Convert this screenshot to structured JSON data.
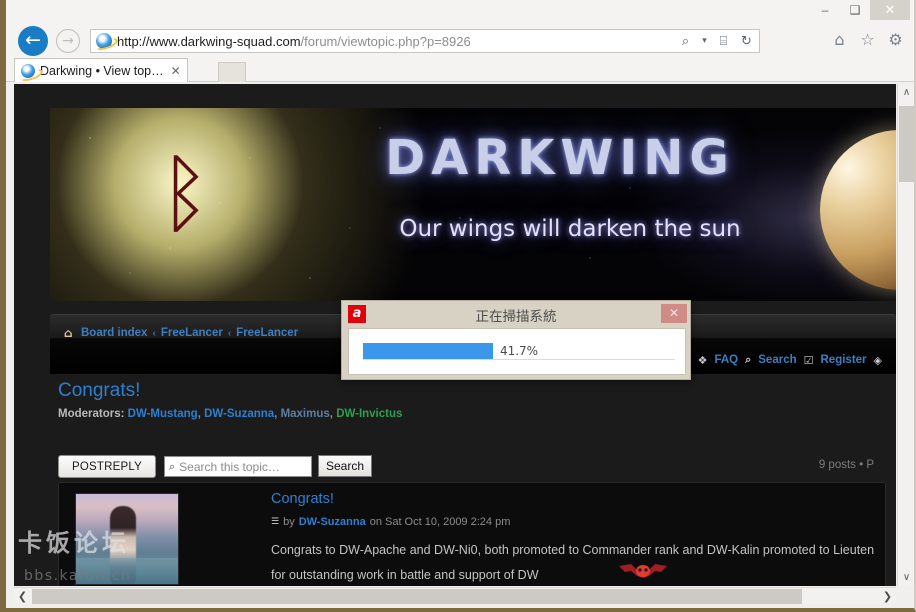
{
  "window": {
    "minimize_label": "–",
    "maximize_label": "❑",
    "close_label": "✕"
  },
  "browser": {
    "back_label": "←",
    "forward_label": "→",
    "url_host": "http://www.darkwing-squad.com",
    "url_path": "/forum/viewtopic.php?p=8926",
    "url_full": "http://www.darkwing-squad.com/forum/viewtopic.php?p=8926",
    "search_icon": "⌕",
    "dropdown_icon": "▾",
    "compat_icon": "⌸",
    "refresh_icon": "↻",
    "home_icon": "⌂",
    "favorites_icon": "☆",
    "settings_icon": "⚙",
    "tab_title": "Darkwing • View top…",
    "tab_close": "✕"
  },
  "banner": {
    "wordmark": "DARKWING",
    "tagline": "Our wings will darken the sun",
    "eagle_icon": "ᛒ"
  },
  "breadcrumb": {
    "home_icon": "⌂",
    "separator": "‹",
    "items": [
      {
        "label": "Board index"
      },
      {
        "label": "FreeLancer"
      },
      {
        "label": "FreeLancer"
      }
    ]
  },
  "navlinks": {
    "items": [
      {
        "icon": "❖",
        "label": "FAQ"
      },
      {
        "icon": "⌕",
        "label": "Search"
      },
      {
        "icon": "☑",
        "label": "Register"
      },
      {
        "icon": "◈",
        "label": ""
      }
    ]
  },
  "topic": {
    "title": "Congrats!",
    "moderators_label": "Moderators:",
    "moderators": [
      {
        "name": "DW-Mustang",
        "color_class": "mod-blue"
      },
      {
        "name": "DW-Suzanna",
        "color_class": "mod-blue"
      },
      {
        "name": "Maximus",
        "color_class": "mod-gray"
      },
      {
        "name": "DW-Invictus",
        "color_class": "mod-green"
      }
    ],
    "post_reply_label": "POSTREPLY",
    "search_placeholder": "Search this topic…",
    "search_value": "",
    "search_button_label": "Search",
    "search_glyph": "⌕",
    "post_count": "9 posts • P"
  },
  "post": {
    "title": "Congrats!",
    "post_icon": "☰",
    "by_label": "by",
    "author": "DW-Suzanna",
    "date": "on Sat Oct 10, 2009 2:24 pm",
    "body_line1": "Congrats to DW-Apache and DW-Ni0, both promoted to Commander rank and DW-Kalin promoted to Lieuten",
    "body_line2": "for outstanding work in battle and support of DW",
    "emoticon": "ᾘ7"
  },
  "scan_dialog": {
    "title": "正在掃描系統",
    "app_icon_letter": "a",
    "close_label": "✕",
    "progress_percent": "41.7%",
    "progress_value": 41.7,
    "fill_color": "#3b97ea"
  },
  "scrollbars": {
    "up_icon": "∧",
    "down_icon": "∨",
    "left_icon": "❮",
    "right_icon": "❯"
  },
  "watermark": {
    "cn_text": "卡饭论坛",
    "url_text": "bbs.kafan.cn"
  }
}
